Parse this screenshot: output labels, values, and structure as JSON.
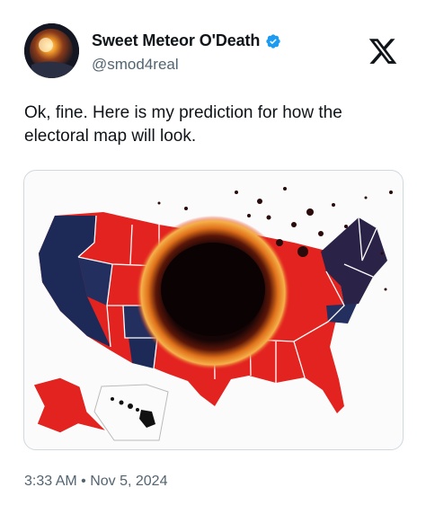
{
  "author": {
    "display_name": "Sweet Meteor O'Death",
    "handle": "@smod4real",
    "verified": true,
    "avatar_icon": "meteor-avatar"
  },
  "platform": {
    "logo_icon": "x-logo-icon"
  },
  "tweet": {
    "text": "Ok, fine. Here is my prediction for how the electoral map will look.",
    "timestamp": "3:33 AM • Nov 5, 2024"
  },
  "media": {
    "description_icon": "us-map-crater-image",
    "colors": {
      "red": "#e3231f",
      "blue": "#1d2a57",
      "crater": "#120606",
      "fire": "#f08a1e"
    }
  },
  "theme": {
    "text_primary": "#0f1419",
    "text_secondary": "#536471",
    "verified_blue": "#1d9bf0",
    "border": "#cfd9de"
  }
}
